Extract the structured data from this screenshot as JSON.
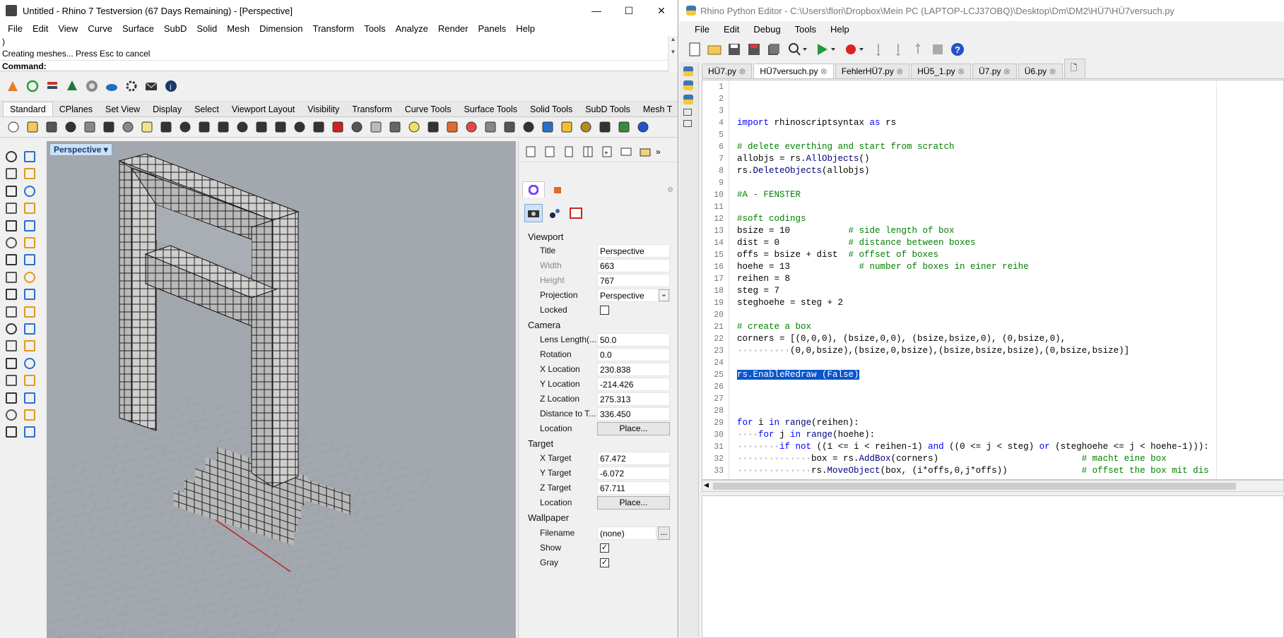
{
  "rhino": {
    "title": "Untitled - Rhino 7 Testversion (67 Days Remaining) - [Perspective]",
    "menu": [
      "File",
      "Edit",
      "View",
      "Curve",
      "Surface",
      "SubD",
      "Solid",
      "Mesh",
      "Dimension",
      "Transform",
      "Tools",
      "Analyze",
      "Render",
      "Panels",
      "Help"
    ],
    "history_line": ")",
    "status_line": "Creating meshes... Press Esc to cancel",
    "command_label": "Command:",
    "command_value": "",
    "toolbar_tabs": [
      "Standard",
      "CPlanes",
      "Set View",
      "Display",
      "Select",
      "Viewport Layout",
      "Visibility",
      "Transform",
      "Curve Tools",
      "Surface Tools",
      "Solid Tools",
      "SubD Tools",
      "Mesh T"
    ],
    "viewport_label": "Perspective"
  },
  "properties": {
    "viewport_section": "Viewport",
    "title_label": "Title",
    "title_value": "Perspective",
    "width_label": "Width",
    "width_value": "663",
    "height_label": "Height",
    "height_value": "767",
    "projection_label": "Projection",
    "projection_value": "Perspective",
    "locked_label": "Locked",
    "camera_section": "Camera",
    "lens_label": "Lens Length(...",
    "lens_value": "50.0",
    "rotation_label": "Rotation",
    "rotation_value": "0.0",
    "xloc_label": "X Location",
    "xloc_value": "230.838",
    "yloc_label": "Y Location",
    "yloc_value": "-214.426",
    "zloc_label": "Z Location",
    "zloc_value": "275.313",
    "dist_label": "Distance to T...",
    "dist_value": "336.450",
    "cam_location_label": "Location",
    "cam_location_button": "Place...",
    "target_section": "Target",
    "xtarget_label": "X Target",
    "xtarget_value": "67.472",
    "ytarget_label": "Y Target",
    "ytarget_value": "-6.072",
    "ztarget_label": "Z Target",
    "ztarget_value": "67.711",
    "tgt_location_label": "Location",
    "tgt_location_button": "Place...",
    "wallpaper_section": "Wallpaper",
    "filename_label": "Filename",
    "filename_value": "(none)",
    "filename_button": "...",
    "show_label": "Show",
    "gray_label": "Gray",
    "locked_checked": false,
    "show_checked": true,
    "gray_checked": true
  },
  "python_editor": {
    "title": "Rhino Python Editor - C:\\Users\\flori\\Dropbox\\Mein PC (LAPTOP-LCJ37OBQ)\\Desktop\\Dm\\DM2\\HÜ7\\HÜ7versuch.py",
    "menu": [
      "File",
      "Edit",
      "Debug",
      "Tools",
      "Help"
    ],
    "tabs": [
      "HÜ7.py",
      "HÜ7versuch.py",
      "FehlerHÜ7.py",
      "HÜ5_1.py",
      "Ü7.py",
      "Ü6.py"
    ],
    "active_tab": 1,
    "lines": [
      {
        "n": "1",
        "text": ""
      },
      {
        "n": "2",
        "text": ""
      },
      {
        "n": "3",
        "text": ""
      },
      {
        "n": "4",
        "text": "import rhinoscriptsyntax as rs"
      },
      {
        "n": "5",
        "text": ""
      },
      {
        "n": "6",
        "text": "# delete everthing and start from scratch"
      },
      {
        "n": "7",
        "text": "allobjs = rs.AllObjects()"
      },
      {
        "n": "8",
        "text": "rs.DeleteObjects(allobjs)"
      },
      {
        "n": "9",
        "text": ""
      },
      {
        "n": "10",
        "text": "#A - FENSTER"
      },
      {
        "n": "11",
        "text": ""
      },
      {
        "n": "12",
        "text": "#soft codings"
      },
      {
        "n": "13",
        "text": "bsize = 10           # side length of box"
      },
      {
        "n": "14",
        "text": "dist = 0             # distance between boxes"
      },
      {
        "n": "15",
        "text": "offs = bsize + dist  # offset of boxes"
      },
      {
        "n": "16",
        "text": "hoehe = 13             # number of boxes in einer reihe"
      },
      {
        "n": "17",
        "text": "reihen = 8"
      },
      {
        "n": "18",
        "text": "steg = 7"
      },
      {
        "n": "19",
        "text": "steghoehe = steg + 2"
      },
      {
        "n": "20",
        "text": ""
      },
      {
        "n": "21",
        "text": "# create a box"
      },
      {
        "n": "22",
        "text": "corners = [(0,0,0), (bsize,0,0), (bsize,bsize,0), (0,bsize,0),"
      },
      {
        "n": "23",
        "text": "··········(0,0,bsize),(bsize,0,bsize),(bsize,bsize,bsize),(0,bsize,bsize)]"
      },
      {
        "n": "24",
        "text": ""
      },
      {
        "n": "25",
        "text": "rs.EnableRedraw (False)"
      },
      {
        "n": "26",
        "text": ""
      },
      {
        "n": "27",
        "text": ""
      },
      {
        "n": "28",
        "text": ""
      },
      {
        "n": "29",
        "text": "for i in range(reihen):"
      },
      {
        "n": "30",
        "text": "····for j in range(hoehe):"
      },
      {
        "n": "31",
        "text": "········if not ((1 <= i < reihen-1) and ((0 <= j < steg) or (steghoehe <= j < hoehe-1))):"
      },
      {
        "n": "32",
        "text": "··············box = rs.AddBox(corners)                           # macht eine box"
      },
      {
        "n": "33",
        "text": "··············rs.MoveObject(box, (i*offs,0,j*offs))              # offset the box mit dis"
      }
    ]
  },
  "colors": {
    "accent_selection": "#0a55c9",
    "comment": "#008000",
    "keyword": "#0000ff",
    "viewport_bg": "#a3a8ae"
  }
}
